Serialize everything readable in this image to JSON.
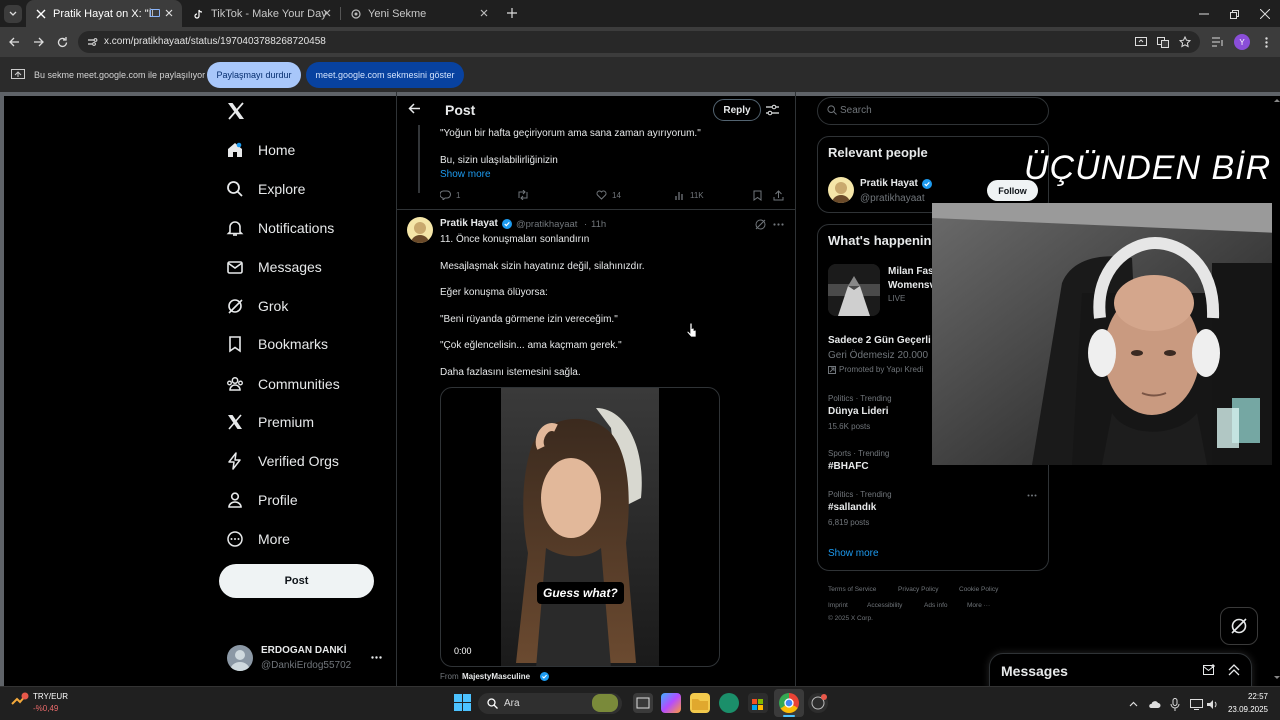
{
  "browser": {
    "tabs": [
      {
        "label": "Pratik Hayat on X: \"İhtiyacı",
        "active": true
      },
      {
        "label": "TikTok - Make Your Day",
        "active": false
      },
      {
        "label": "Yeni Sekme",
        "active": false
      }
    ],
    "url": "x.com/pratikhayaat/status/1970403788268720458",
    "profile_initial": "Y"
  },
  "share_bar": {
    "text": "Bu sekme meet.google.com ile paylaşılıyor",
    "stop_label": "Paylaşmayı durdur",
    "show_label": "meet.google.com sekmesini göster"
  },
  "nav": {
    "items": [
      "Home",
      "Explore",
      "Notifications",
      "Messages",
      "Grok",
      "Bookmarks",
      "Communities",
      "Premium",
      "Verified Orgs",
      "Profile",
      "More"
    ],
    "post_label": "Post",
    "account_name": "ERDOGAN DANKİ",
    "account_handle": "@DankiErdog55702"
  },
  "header": {
    "title": "Post",
    "reply_label": "Reply"
  },
  "prev_tweet": {
    "line1": "\"Yoğun bir hafta geçiriyorum ama sana zaman ayırıyorum.\"",
    "line2": "Bu, sizin ulaşılabilirliğinizin",
    "show_more": "Show more",
    "replies": "1",
    "likes": "14",
    "views": "11K"
  },
  "tweet": {
    "author": "Pratik Hayat",
    "handle": "@pratikhayaat",
    "time": "11h",
    "lines": [
      "11. Önce konuşmaları sonlandırın",
      "Mesajlaşmak sizin hayatınız değil, silahınızdır.",
      "Eğer konuşma ölüyorsa:",
      "\"Beni rüyanda görmene izin vereceğim.\"",
      "\"Çok eğlencelisin... ama kaçmam gerek.\"",
      "Daha fazlasını istemesini sağla."
    ],
    "video_caption": "Guess what?",
    "video_time": "0:00",
    "from_label": "From",
    "from_account": "MajestyMasculine"
  },
  "sidebar": {
    "search_placeholder": "Search",
    "relevant_title": "Relevant people",
    "person_name": "Pratik Hayat",
    "person_handle": "@pratikhayaat",
    "follow_label": "Follow",
    "happening_title": "What's happenin",
    "event_title_1": "Milan Fas",
    "event_title_2": "Womensv",
    "event_status": "LIVE",
    "promo_title": "Sadece 2 Gün Geçerli",
    "promo_sub": "Geri Ödemesiz 20.000",
    "promo_by": "Promoted by Yapı Kredi",
    "trends": [
      {
        "meta": "Politics · Trending",
        "title": "Dünya Lideri",
        "count": "15.6K posts"
      },
      {
        "meta": "Sports · Trending",
        "title": "#BHAFC",
        "count": ""
      },
      {
        "meta": "Politics · Trending",
        "title": "#sallandık",
        "count": "6,819 posts"
      }
    ],
    "show_more": "Show more",
    "footer_1": [
      "Terms of Service",
      "Privacy Policy",
      "Cookie Policy"
    ],
    "footer_2": [
      "Imprint",
      "Accessibility",
      "Ads info",
      "More ···"
    ],
    "copyright": "© 2025 X Corp.",
    "messages_label": "Messages"
  },
  "overlay_text": "ÜÇÜNDEN BİRİ",
  "taskbar": {
    "currency": "TRY/EUR",
    "change": "-%0,49",
    "search": "Ara",
    "time": "22:57",
    "date": "23.09.2025"
  },
  "colors": {
    "x_blue": "#1d9bf0",
    "meet_pill": "#a8c7fa",
    "meet_pill_dark": "#0b57d0",
    "negative": "#e86a6a"
  }
}
